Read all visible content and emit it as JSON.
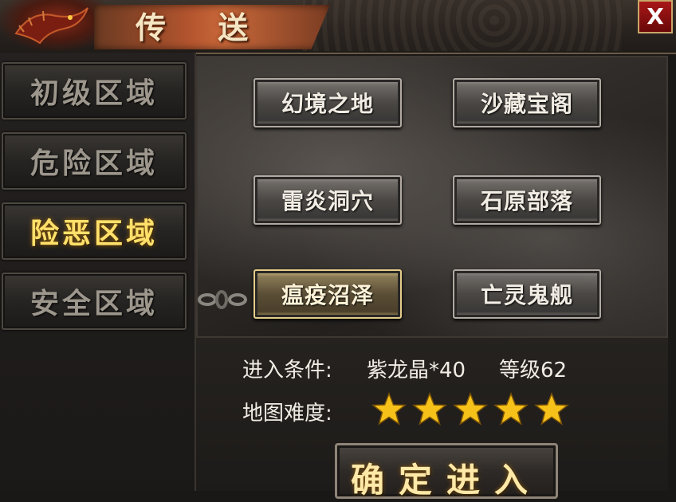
{
  "window": {
    "title": "传 送",
    "close_label": "X"
  },
  "regions": [
    {
      "label": "初级区域",
      "active": false
    },
    {
      "label": "危险区域",
      "active": false
    },
    {
      "label": "险恶区域",
      "active": true
    },
    {
      "label": "安全区域",
      "active": false
    }
  ],
  "maps": [
    {
      "label": "幻境之地",
      "selected": false
    },
    {
      "label": "沙藏宝阁",
      "selected": false
    },
    {
      "label": "雷炎洞穴",
      "selected": false
    },
    {
      "label": "石原部落",
      "selected": false
    },
    {
      "label": "瘟疫沼泽",
      "selected": true
    },
    {
      "label": "亡灵鬼舰",
      "selected": false
    }
  ],
  "info": {
    "condition_label": "进入条件:",
    "condition_item": "紫龙晶*40",
    "condition_level": "等级62",
    "difficulty_label": "地图难度:",
    "difficulty_stars": 5
  },
  "enter_button": {
    "label": "确定进入"
  },
  "colors": {
    "active_gold": "#ffe06a",
    "close_red": "#a81818",
    "star_gold": "#f6c21a"
  }
}
